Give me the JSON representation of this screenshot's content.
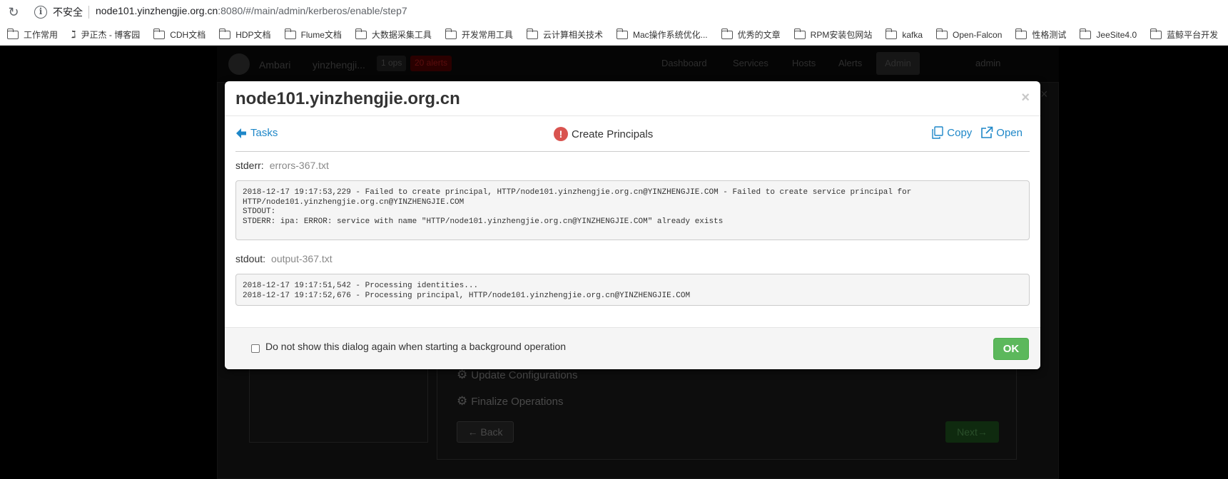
{
  "browser": {
    "security_label": "不安全",
    "url_host": "node101.yinzhengjie.org.cn",
    "url_rest": ":8080/#/main/admin/kerberos/enable/step7",
    "bookmarks": [
      {
        "label": "工作常用",
        "icon": "folder"
      },
      {
        "label": "尹正杰 - 博客园",
        "icon": "blog-logo"
      },
      {
        "label": "CDH文档",
        "icon": "folder"
      },
      {
        "label": "HDP文档",
        "icon": "folder"
      },
      {
        "label": "Flume文档",
        "icon": "folder"
      },
      {
        "label": "大数据采集工具",
        "icon": "folder"
      },
      {
        "label": "开发常用工具",
        "icon": "folder"
      },
      {
        "label": "云计算相关技术",
        "icon": "folder"
      },
      {
        "label": "Mac操作系统优化...",
        "icon": "folder"
      },
      {
        "label": "优秀的文章",
        "icon": "folder"
      },
      {
        "label": "RPM安装包网站",
        "icon": "folder"
      },
      {
        "label": "kafka",
        "icon": "folder"
      },
      {
        "label": "Open-Falcon",
        "icon": "folder"
      },
      {
        "label": "性格测试",
        "icon": "folder"
      },
      {
        "label": "JeeSite4.0",
        "icon": "folder"
      },
      {
        "label": "蓝鲸平台开发",
        "icon": "folder"
      }
    ]
  },
  "background": {
    "nav": {
      "brand": "Ambari",
      "cluster": "yinzhengji...",
      "ops_badge": "1 ops",
      "alerts_badge": "20 alerts",
      "links": [
        "Dashboard",
        "Services",
        "Hosts",
        "Alerts",
        "Admin"
      ],
      "user": "admin"
    },
    "steps": [
      "Update Configurations",
      "Finalize Operations"
    ],
    "back_label": "← Back",
    "next_label": "Next→"
  },
  "modal": {
    "title": "node101.yinzhengjie.org.cn",
    "back_label": "Tasks",
    "task_title": "Create Principals",
    "copy_label": "Copy",
    "open_label": "Open",
    "stderr_label": "stderr:",
    "stderr_file": "errors-367.txt",
    "stderr_text": "2018-12-17 19:17:53,229 - Failed to create principal, HTTP/node101.yinzhengjie.org.cn@YINZHENGJIE.COM - Failed to create service principal for\nHTTP/node101.yinzhengjie.org.cn@YINZHENGJIE.COM\nSTDOUT:\nSTDERR: ipa: ERROR: service with name \"HTTP/node101.yinzhengjie.org.cn@YINZHENGJIE.COM\" already exists",
    "stdout_label": "stdout:",
    "stdout_file": "output-367.txt",
    "stdout_text": "2018-12-17 19:17:51,542 - Processing identities...\n2018-12-17 19:17:52,676 - Processing principal, HTTP/node101.yinzhengjie.org.cn@YINZHENGJIE.COM",
    "checkbox_label": "Do not show this dialog again when starting a background operation",
    "ok_label": "OK"
  },
  "colors": {
    "link": "#1e87c8",
    "error": "#d9534f",
    "ok": "#5cb85c"
  }
}
